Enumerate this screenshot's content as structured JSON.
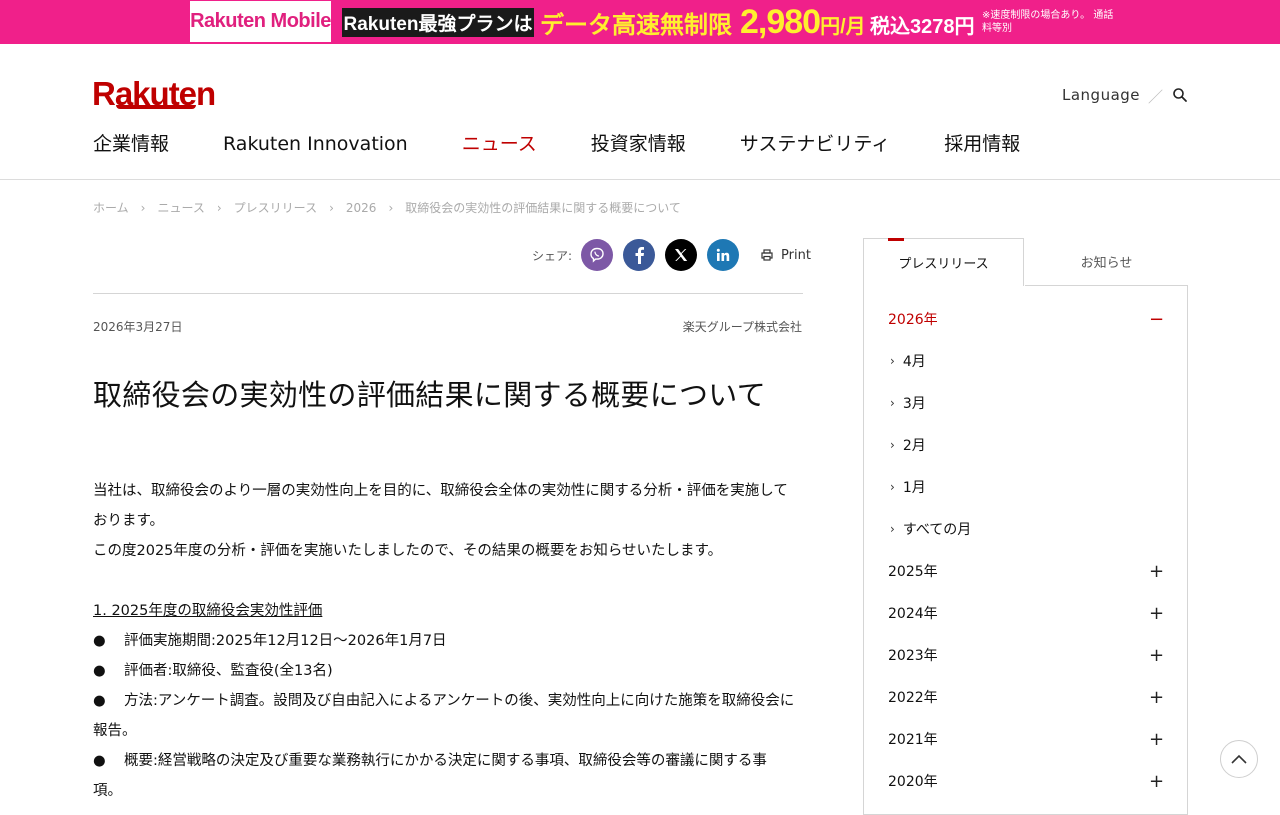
{
  "banner": {
    "logo": "Rakuten Mobile",
    "plan": "Rakuten最強プランは",
    "copy_main": "データ高速無制限",
    "price": "2,980",
    "per_month": "円/月",
    "tax_included": "税込3278円",
    "note": "※速度制限の場合あり。 通話料等別",
    "colors": {
      "background": "#f0208a",
      "copy": "#ffef2e"
    }
  },
  "header": {
    "logo": "Rakuten",
    "language": "Language",
    "nav": [
      "企業情報",
      "Rakuten Innovation",
      "ニュース",
      "投資家情報",
      "サステナビリティ",
      "採用情報"
    ],
    "active_nav": "ニュース",
    "colors": {
      "brand": "#bf0000"
    }
  },
  "breadcrumb": [
    "ホーム",
    "ニュース",
    "プレスリリース",
    "2026",
    "取締役会の実効性の評価結果に関する概要について"
  ],
  "share": {
    "label": "シェア:",
    "buttons": [
      "viber-icon",
      "facebook-icon",
      "x-icon",
      "linkedin-icon"
    ],
    "print": "Print"
  },
  "article": {
    "date": "2026年3月27日",
    "company": "楽天グループ株式会社",
    "title": "取締役会の実効性の評価結果に関する概要について",
    "p1_line1": "当社は、取締役会のより一層の実効性向上を目的に、取締役会全体の実効性に関する分析・評価を実施して",
    "p1_line2": "おります。",
    "p2": "この度2025年度の分析・評価を実施いたしましたので、その結果の概要をお知らせいたします。",
    "section1": "1. 2025年度の取締役会実効性評価",
    "bullets": [
      {
        "line1": "評価実施期間:2025年12月12日～2026年1月7日"
      },
      {
        "line1": "評価者:取締役、監査役(全13名)"
      },
      {
        "line1": "方法:アンケート調査。設問及び自由記入によるアンケートの後、実効性向上に向けた施策を取締役会に",
        "line2": "報告。"
      },
      {
        "line1": "概要:経営戦略の決定及び重要な業務執行にかかる決定に関する事項、取締役会等の審議に関する事",
        "line2": "項。"
      }
    ]
  },
  "sidebar": {
    "tabs": [
      "プレスリリース",
      "お知らせ"
    ],
    "active_tab": "プレスリリース",
    "open_year": "2026年",
    "months": [
      "4月",
      "3月",
      "2月",
      "1月",
      "すべての月"
    ],
    "years": [
      "2025年",
      "2024年",
      "2023年",
      "2022年",
      "2021年",
      "2020年"
    ]
  }
}
